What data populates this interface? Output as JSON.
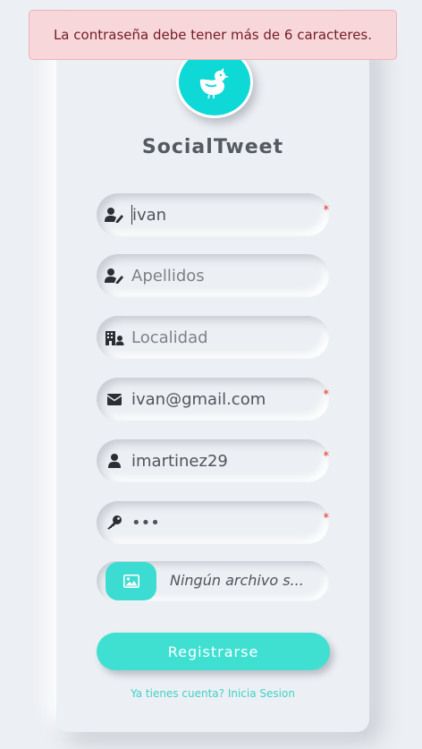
{
  "alert": {
    "message": "La contraseña debe tener más de 6 caracteres."
  },
  "brand": {
    "name": "SocialTweet",
    "logo_icon": "bird-icon",
    "color": "#0fd9d6"
  },
  "form": {
    "fields": [
      {
        "name": "nombre",
        "icon": "user-edit-icon",
        "value": "ivan",
        "placeholder": "",
        "required": true
      },
      {
        "name": "apellidos",
        "icon": "user-edit-icon",
        "value": "",
        "placeholder": "Apellidos",
        "required": false
      },
      {
        "name": "localidad",
        "icon": "building-user-icon",
        "value": "",
        "placeholder": "Localidad",
        "required": false
      },
      {
        "name": "email",
        "icon": "envelope-icon",
        "value": "ivan@gmail.com",
        "placeholder": "",
        "required": true
      },
      {
        "name": "usuario",
        "icon": "user-icon",
        "value": "imartinez29",
        "placeholder": "",
        "required": true
      },
      {
        "name": "password",
        "icon": "key-icon",
        "value": "•••",
        "placeholder": "",
        "required": true
      }
    ],
    "required_mark": "*",
    "file": {
      "icon": "image-icon",
      "text": "Ningún archivo s..."
    },
    "submit_label": "Registrarse",
    "login_link": "Ya tienes cuenta? Inicia Sesion"
  },
  "colors": {
    "accent": "#3fe0d2",
    "background": "#eceff3",
    "required": "#ee2b2b",
    "alert_bg": "#f8d7da",
    "alert_text": "#721c24"
  }
}
